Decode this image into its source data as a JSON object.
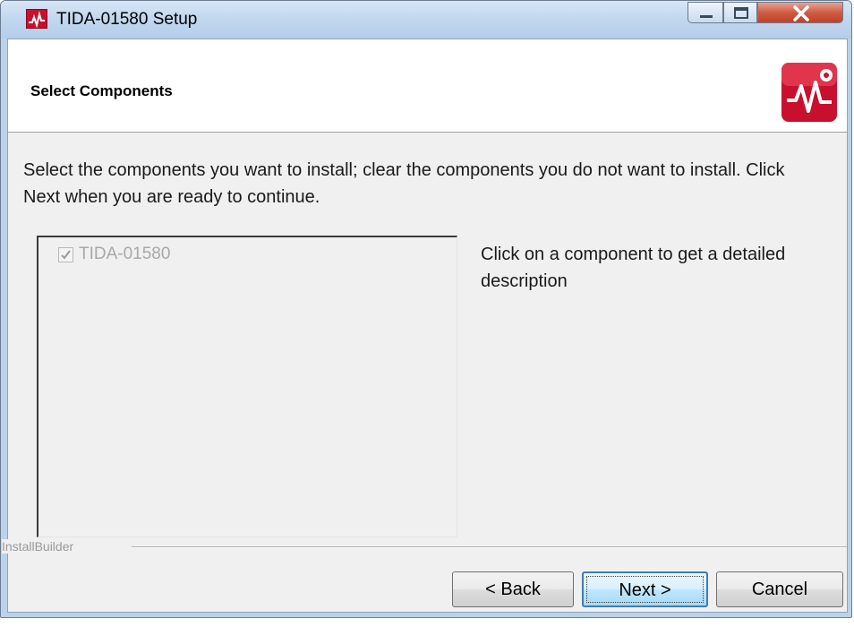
{
  "window": {
    "title": "TIDA-01580 Setup",
    "app_icon": "installer-app-icon",
    "controls": [
      "minimize-icon",
      "maximize-icon",
      "close-icon"
    ]
  },
  "header": {
    "title": "Select Components",
    "logo_icon": "red-waveform-logo-icon"
  },
  "instructions": "Select the components you want to install; clear the components you do not want to install. Click Next when you are ready to continue.",
  "components": {
    "items": [
      {
        "label": "TIDA-01580",
        "checked": true,
        "disabled": true
      }
    ]
  },
  "description": "Click on a component to get a detailed description",
  "footer": {
    "brand": "InstallBuilder",
    "back_label": "< Back",
    "next_label": "Next >",
    "cancel_label": "Cancel"
  },
  "colors": {
    "accent_red": "#c8102e",
    "focus_blue": "#3c7fb1",
    "titlebar": "#c3d8ef"
  }
}
